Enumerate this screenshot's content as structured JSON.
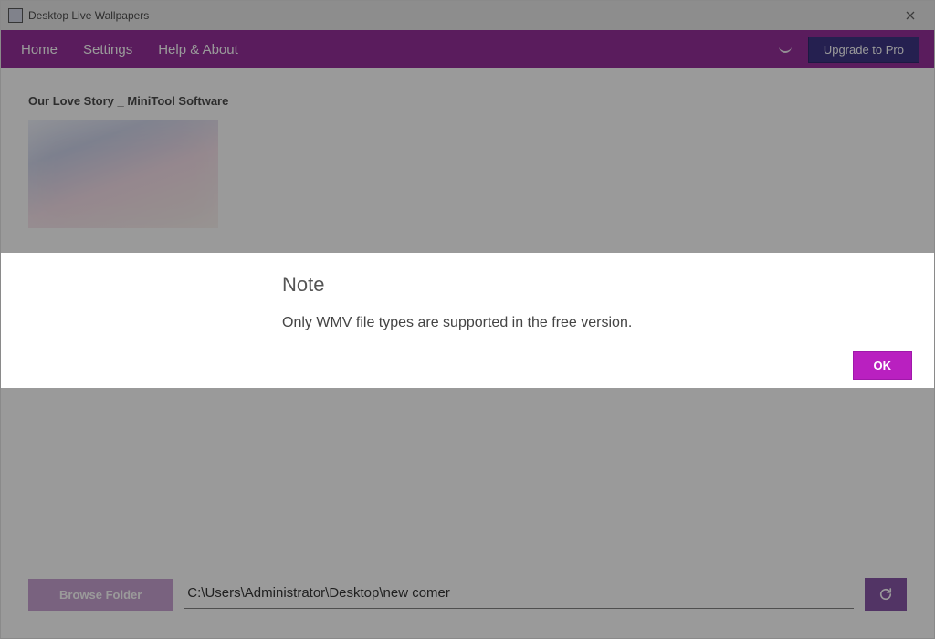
{
  "titlebar": {
    "app_title": "Desktop Live Wallpapers"
  },
  "menu": {
    "home": "Home",
    "settings": "Settings",
    "help": "Help & About",
    "upgrade": "Upgrade to Pro"
  },
  "playlist": {
    "title": "Our Love Story _ MiniTool Software"
  },
  "bottom": {
    "browse_label": "Browse Folder",
    "path_value": "C:\\Users\\Administrator\\Desktop\\new comer"
  },
  "modal": {
    "title": "Note",
    "body": "Only WMV file types are supported in the free version.",
    "ok_label": "OK"
  }
}
